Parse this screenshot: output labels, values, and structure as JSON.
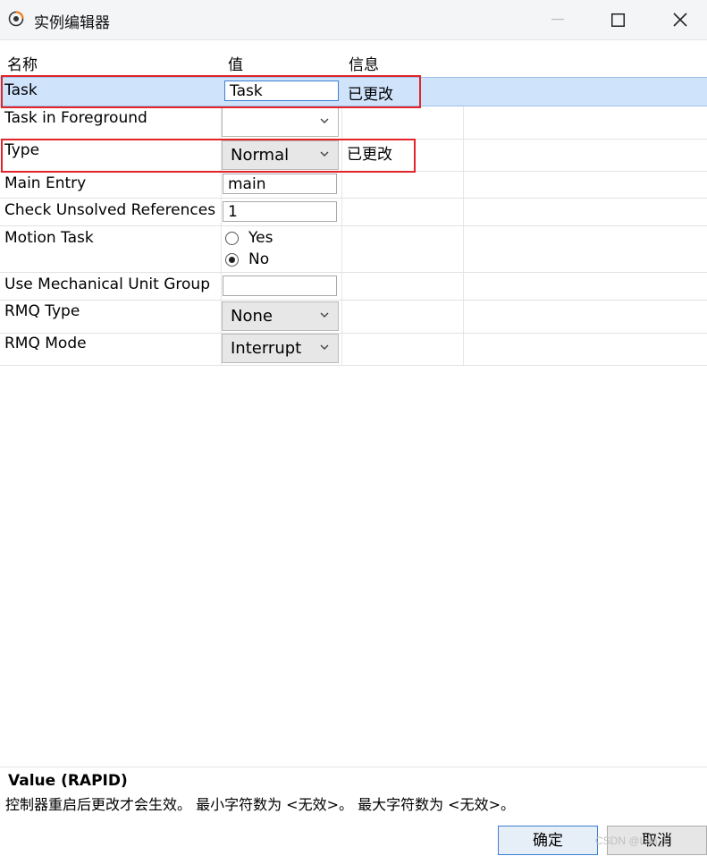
{
  "window": {
    "title": "实例编辑器",
    "icons": [
      "app-icon",
      "minimize-icon",
      "maximize-icon",
      "close-icon"
    ]
  },
  "table": {
    "headers": [
      "名称",
      "值",
      "信息"
    ],
    "rows": [
      {
        "name": "Task",
        "value": "Task",
        "info": "已更改",
        "control": "textbox",
        "selected": true
      },
      {
        "name": "Task in Foreground",
        "value": "",
        "info": "",
        "control": "combo"
      },
      {
        "name": "Type",
        "value": "Normal",
        "info": "已更改",
        "control": "combo"
      },
      {
        "name": "Main Entry",
        "value": "main",
        "info": "",
        "control": "textbox"
      },
      {
        "name": "Check Unsolved References",
        "value": "1",
        "info": "",
        "control": "textbox"
      },
      {
        "name": "Motion Task",
        "options": [
          "Yes",
          "No"
        ],
        "selected_option": "No",
        "info": "",
        "control": "radio"
      },
      {
        "name": "Use Mechanical Unit Group",
        "value": "",
        "info": "",
        "control": "textbox"
      },
      {
        "name": "RMQ Type",
        "value": "None",
        "info": "",
        "control": "combo"
      },
      {
        "name": "RMQ Mode",
        "value": "Interrupt",
        "info": "",
        "control": "combo"
      }
    ]
  },
  "description": {
    "title": "Value (RAPID)",
    "text": "控制器重启后更改才会生效。 最小字符数为 <无效>。 最大字符数为 <无效>。"
  },
  "buttons": {
    "ok": "确定",
    "cancel": "取消"
  },
  "watermark": "CSDN @Lan_L",
  "colors": {
    "highlight": "#e32428",
    "selected_row": "#cfe3fb"
  }
}
